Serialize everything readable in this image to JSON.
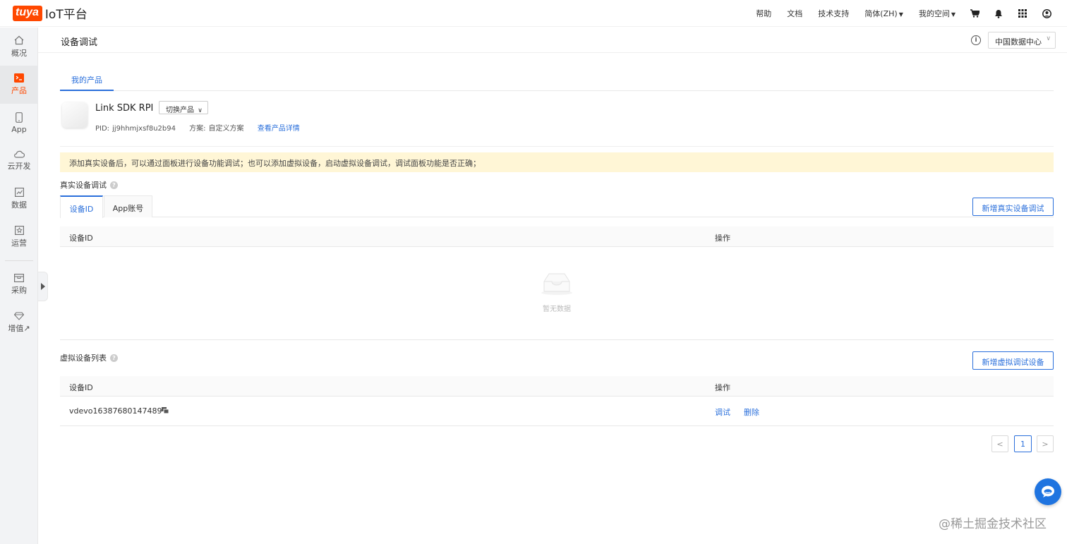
{
  "topbar": {
    "logo_mark": "tuya",
    "logo_text": "IoT平台",
    "nav": [
      "帮助",
      "文档",
      "技术支持"
    ],
    "language": "简体(ZH)",
    "my_space": "我的空间",
    "icons": [
      "cart-icon",
      "bell-icon",
      "apps-grid-icon",
      "user-icon"
    ]
  },
  "sidebar": {
    "items": [
      {
        "label": "概况",
        "icon": "home-icon"
      },
      {
        "label": "产品",
        "icon": "terminal-icon"
      },
      {
        "label": "App",
        "icon": "phone-icon"
      },
      {
        "label": "云开发",
        "icon": "cloud-icon"
      },
      {
        "label": "数据",
        "icon": "chart-icon"
      },
      {
        "label": "运营",
        "icon": "star-icon"
      },
      {
        "label": "采购",
        "icon": "box-icon"
      },
      {
        "label": "增值↗",
        "icon": "diamond-icon"
      }
    ],
    "active_index": 1
  },
  "header": {
    "title": "设备调试",
    "data_center": "中国数据中心"
  },
  "product_tabs": [
    "我的产品"
  ],
  "product": {
    "name": "Link SDK RPI",
    "switch_label": "切换产品",
    "pid_label": "PID:",
    "pid": "jj9hhmjxsf8u2b94",
    "scheme_label": "方案:",
    "scheme": "自定义方案",
    "detail_link": "查看产品详情"
  },
  "notice": "添加真实设备后，可以通过面板进行设备功能调试；也可以添加虚拟设备，启动虚拟设备调试，调试面板功能是否正确；",
  "real_debug": {
    "label": "真实设备调试",
    "tabs": [
      "设备ID",
      "App账号"
    ],
    "add_button": "新增真实设备调试",
    "columns": [
      "设备ID",
      "操作"
    ],
    "empty_text": "暂无数据"
  },
  "virtual_list": {
    "label": "虚拟设备列表",
    "add_button": "新增虚拟调试设备",
    "columns": [
      "设备ID",
      "操作"
    ],
    "rows": [
      {
        "id": "vdevo163876801474897",
        "actions": [
          "调试",
          "删除"
        ]
      }
    ]
  },
  "pagination": {
    "prev": "<",
    "current": "1",
    "next": ">"
  },
  "watermark": "@稀土掘金技术社区",
  "colors": {
    "brand": "#ff4800",
    "link": "#2a6fdb",
    "notice_bg": "#fff6d6"
  }
}
